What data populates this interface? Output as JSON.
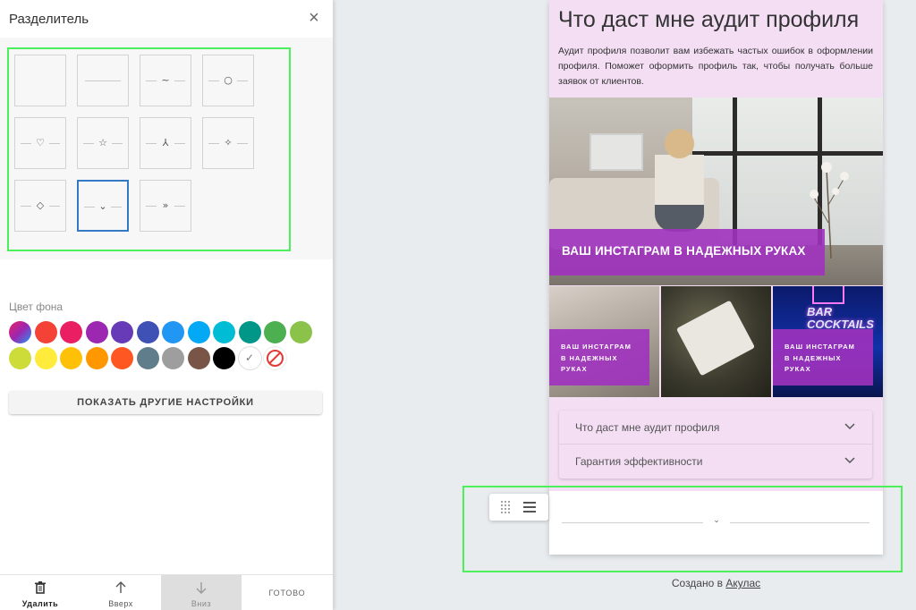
{
  "panel": {
    "title": "Разделитель",
    "close_icon": "close-icon",
    "separators": [
      {
        "id": "none",
        "glyph": ""
      },
      {
        "id": "line",
        "glyph": ""
      },
      {
        "id": "wave",
        "glyph": "~"
      },
      {
        "id": "circle",
        "glyph": "○"
      },
      {
        "id": "heart",
        "glyph": "♡"
      },
      {
        "id": "star",
        "glyph": "☆"
      },
      {
        "id": "tri-arrow",
        "glyph": "⅄"
      },
      {
        "id": "sparkle",
        "glyph": "✧"
      },
      {
        "id": "diamond",
        "glyph": "◇"
      },
      {
        "id": "chevron",
        "glyph": "⌄",
        "selected": true
      },
      {
        "id": "double-chevron",
        "glyph": "»"
      }
    ],
    "bg_label": "Цвет фона",
    "swatches_row1": [
      "#8e5fd8",
      "#f44336",
      "#e91e63",
      "#9c27b0",
      "#673ab7",
      "#3f51b5",
      "#2196f3",
      "#03a9f4",
      "#00bcd4",
      "#009688",
      "#4caf50",
      "#8bc34a"
    ],
    "swatches_row2": [
      "#cddc39",
      "#ffeb3b",
      "#ffc107",
      "#ff9800",
      "#ff5722",
      "#607d8b",
      "#9e9e9e",
      "#795548",
      "#000000",
      "#ffffff",
      "none"
    ],
    "white_check": "✓",
    "more_button": "ПОКАЗАТЬ ДРУГИЕ НАСТРОЙКИ",
    "bottom": {
      "delete": "Удалить",
      "up": "Вверх",
      "down": "Вниз",
      "done": "ГОТОВО"
    }
  },
  "preview": {
    "title": "Что даст мне аудит профиля",
    "text": "Аудит профиля позволит вам избежать частых ошибок в оформлении профиля. Поможет оформить профиль так, чтобы получать больше заявок от клиентов.",
    "hero_caption": "ВАШ ИНСТАГРАМ В НАДЕЖНЫХ РУКАХ",
    "tile_caption": "ВАШ ИНСТАГРАМ\nВ НАДЕЖНЫХ\nРУКАХ",
    "neon_text": "BAR\nCOCKTAILS",
    "accordion": [
      {
        "label": "Что даст мне аудит профиля"
      },
      {
        "label": "Гарантия эффективности"
      }
    ],
    "separator_glyph": "⌄"
  },
  "credit": {
    "prefix": "Создано в ",
    "link": "Акулас"
  }
}
